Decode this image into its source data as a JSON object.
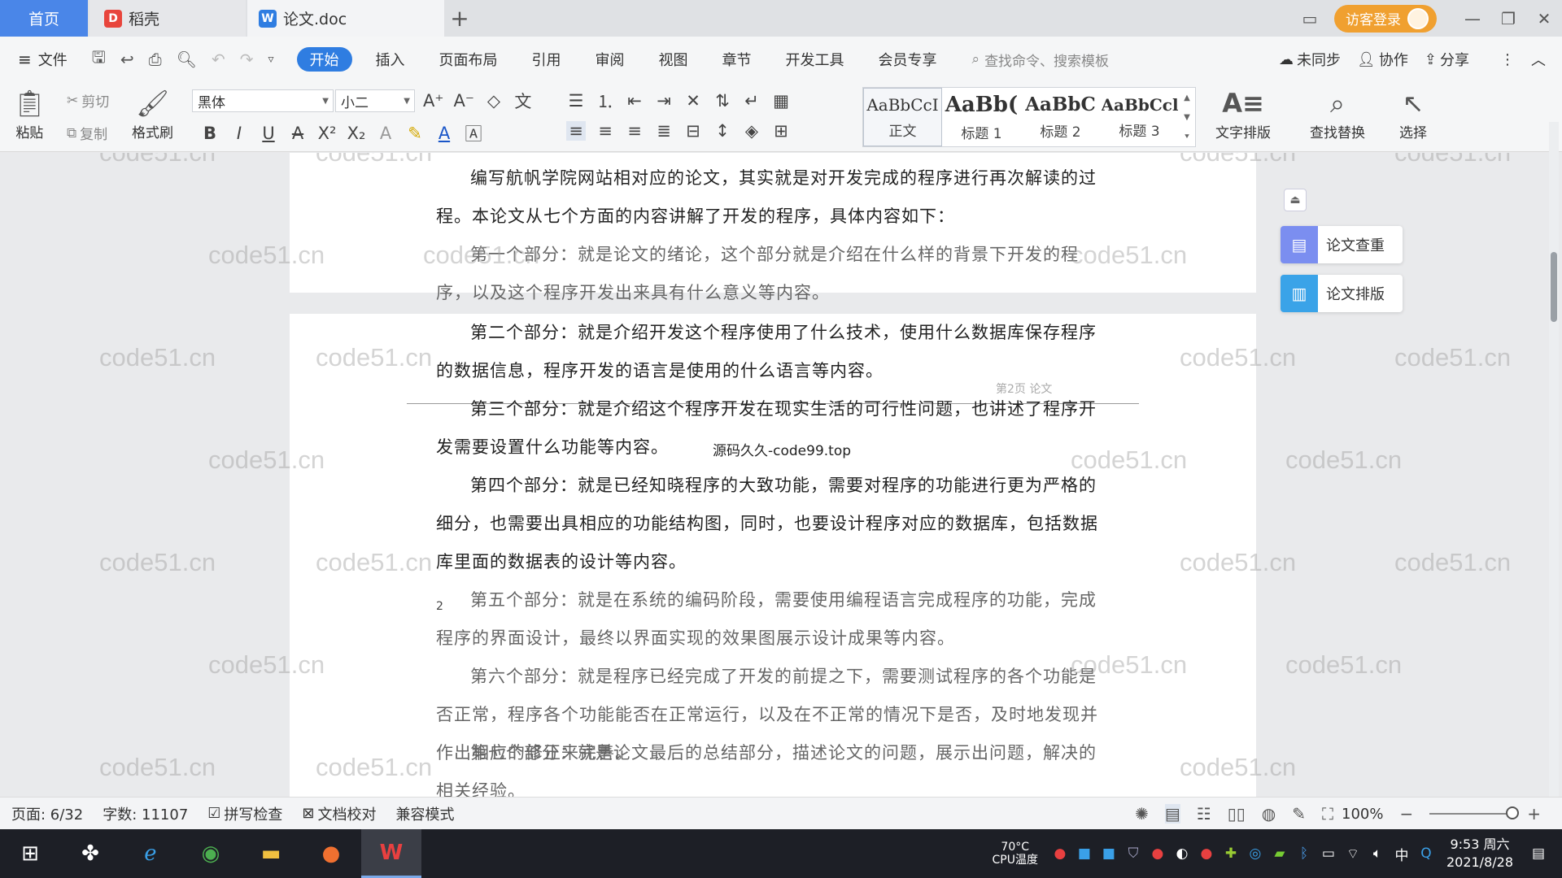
{
  "tabs": {
    "home": "首页",
    "daoke": "稻壳",
    "doc": "论文.doc",
    "add": "+",
    "login": "访客登录"
  },
  "menu": {
    "file": "文件",
    "items": [
      "开始",
      "插入",
      "页面布局",
      "引用",
      "审阅",
      "视图",
      "章节",
      "开发工具",
      "会员专享"
    ],
    "search_placeholder": "查找命令、搜索模板",
    "sync": "未同步",
    "collab": "协作",
    "share": "分享"
  },
  "ribbon": {
    "paste": "粘贴",
    "cut": "剪切",
    "copy": "复制",
    "format_painter": "格式刷",
    "font": "黑体",
    "size": "小二",
    "styles": [
      {
        "preview": "AaBbCcI",
        "name": "正文"
      },
      {
        "preview": "AaBb(",
        "name": "标题 1"
      },
      {
        "preview": "AaBbC",
        "name": "标题 2"
      },
      {
        "preview": "AaBbCcl",
        "name": "标题 3"
      }
    ],
    "text_layout": "文字排版",
    "find_replace": "查找替换",
    "select": "选择"
  },
  "document": {
    "page1_paragraphs": [
      "编写航帆学院网站相对应的论文，其实就是对开发完成的程序进行再次解读的过程。本论文从七个方面的内容讲解了开发的程序，具体内容如下：",
      "第一个部分：就是论文的绪论，这个部分就是介绍在什么样的背景下开发的程序，以及这个程序开发出来具有什么意义等内容。"
    ],
    "page2_paragraphs": [
      "第二个部分：就是介绍开发这个程序使用了什么技术，使用什么数据库保存程序的数据信息，程序开发的语言是使用的什么语言等内容。",
      "第三个部分：就是介绍这个程序开发在现实生活的可行性问题，也讲述了程序开发需要设置什么功能等内容。",
      "第四个部分：就是已经知晓程序的大致功能，需要对程序的功能进行更为严格的细分，也需要出具相应的功能结构图，同时，也要设计程序对应的数据库，包括数据库里面的数据表的设计等内容。",
      "第五个部分：就是在系统的编码阶段，需要使用编程语言完成程序的功能，完成程序的界面设计，最终以界面实现的效果图展示设计成果等内容。",
      "第六个部分：就是程序已经完成了开发的前提之下，需要测试程序的各个功能是否正常，程序各个功能能否在正常运行，以及在不正常的情况下是否，及时地发现并作出相应的修正来完善。",
      "第七个部分：就是论文最后的总结部分，描述论文的问题，展示出问题，解决的相关经验。"
    ],
    "overlay_text": "源码久久-code99.top",
    "header_mark": "第2页 论文",
    "page_number": "2",
    "watermark": "code51.cn"
  },
  "side_panel": {
    "check": "论文查重",
    "layout": "论文排版"
  },
  "status": {
    "page": "页面: 6/32",
    "words": "字数: 11107",
    "spell": "拼写检查",
    "proof": "文档校对",
    "compat": "兼容模式",
    "zoom": "100%"
  },
  "taskbar": {
    "cpu_temp": "70°C",
    "cpu_label": "CPU温度",
    "ime": "中",
    "time": "9:53 周六",
    "date": "2021/8/28"
  },
  "colors": {
    "accent": "#2f7de1",
    "home_tab": "#4a86e8",
    "login": "#f0a030"
  }
}
